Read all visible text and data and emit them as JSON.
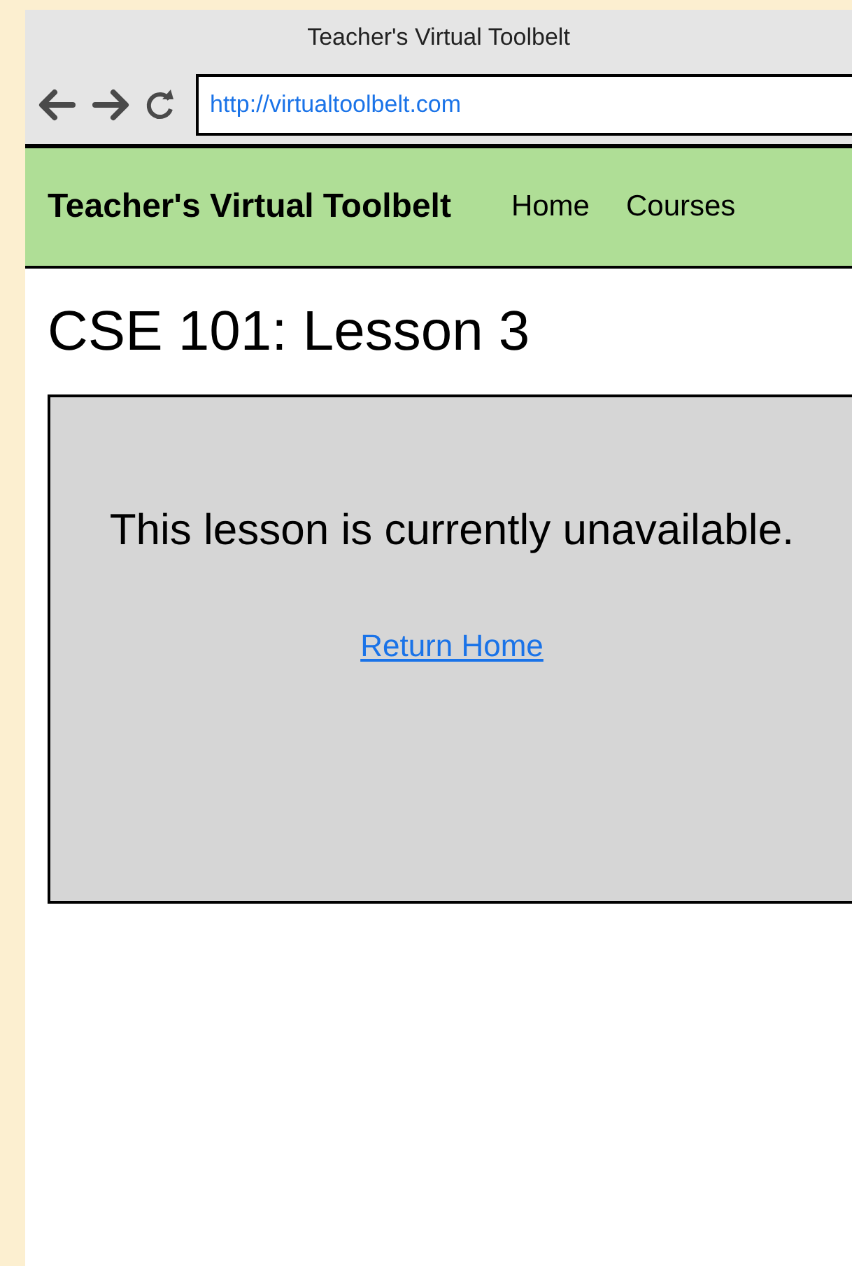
{
  "window": {
    "title": "Teacher's Virtual Toolbelt"
  },
  "address_bar": {
    "value": "http://virtualtoolbelt.com"
  },
  "navbar": {
    "brand": "Teacher's Virtual Toolbelt",
    "links": [
      "Home",
      "Courses"
    ]
  },
  "page": {
    "heading": "CSE 101: Lesson 3",
    "message": "This lesson is currently unavailable.",
    "link": "Return Home"
  }
}
